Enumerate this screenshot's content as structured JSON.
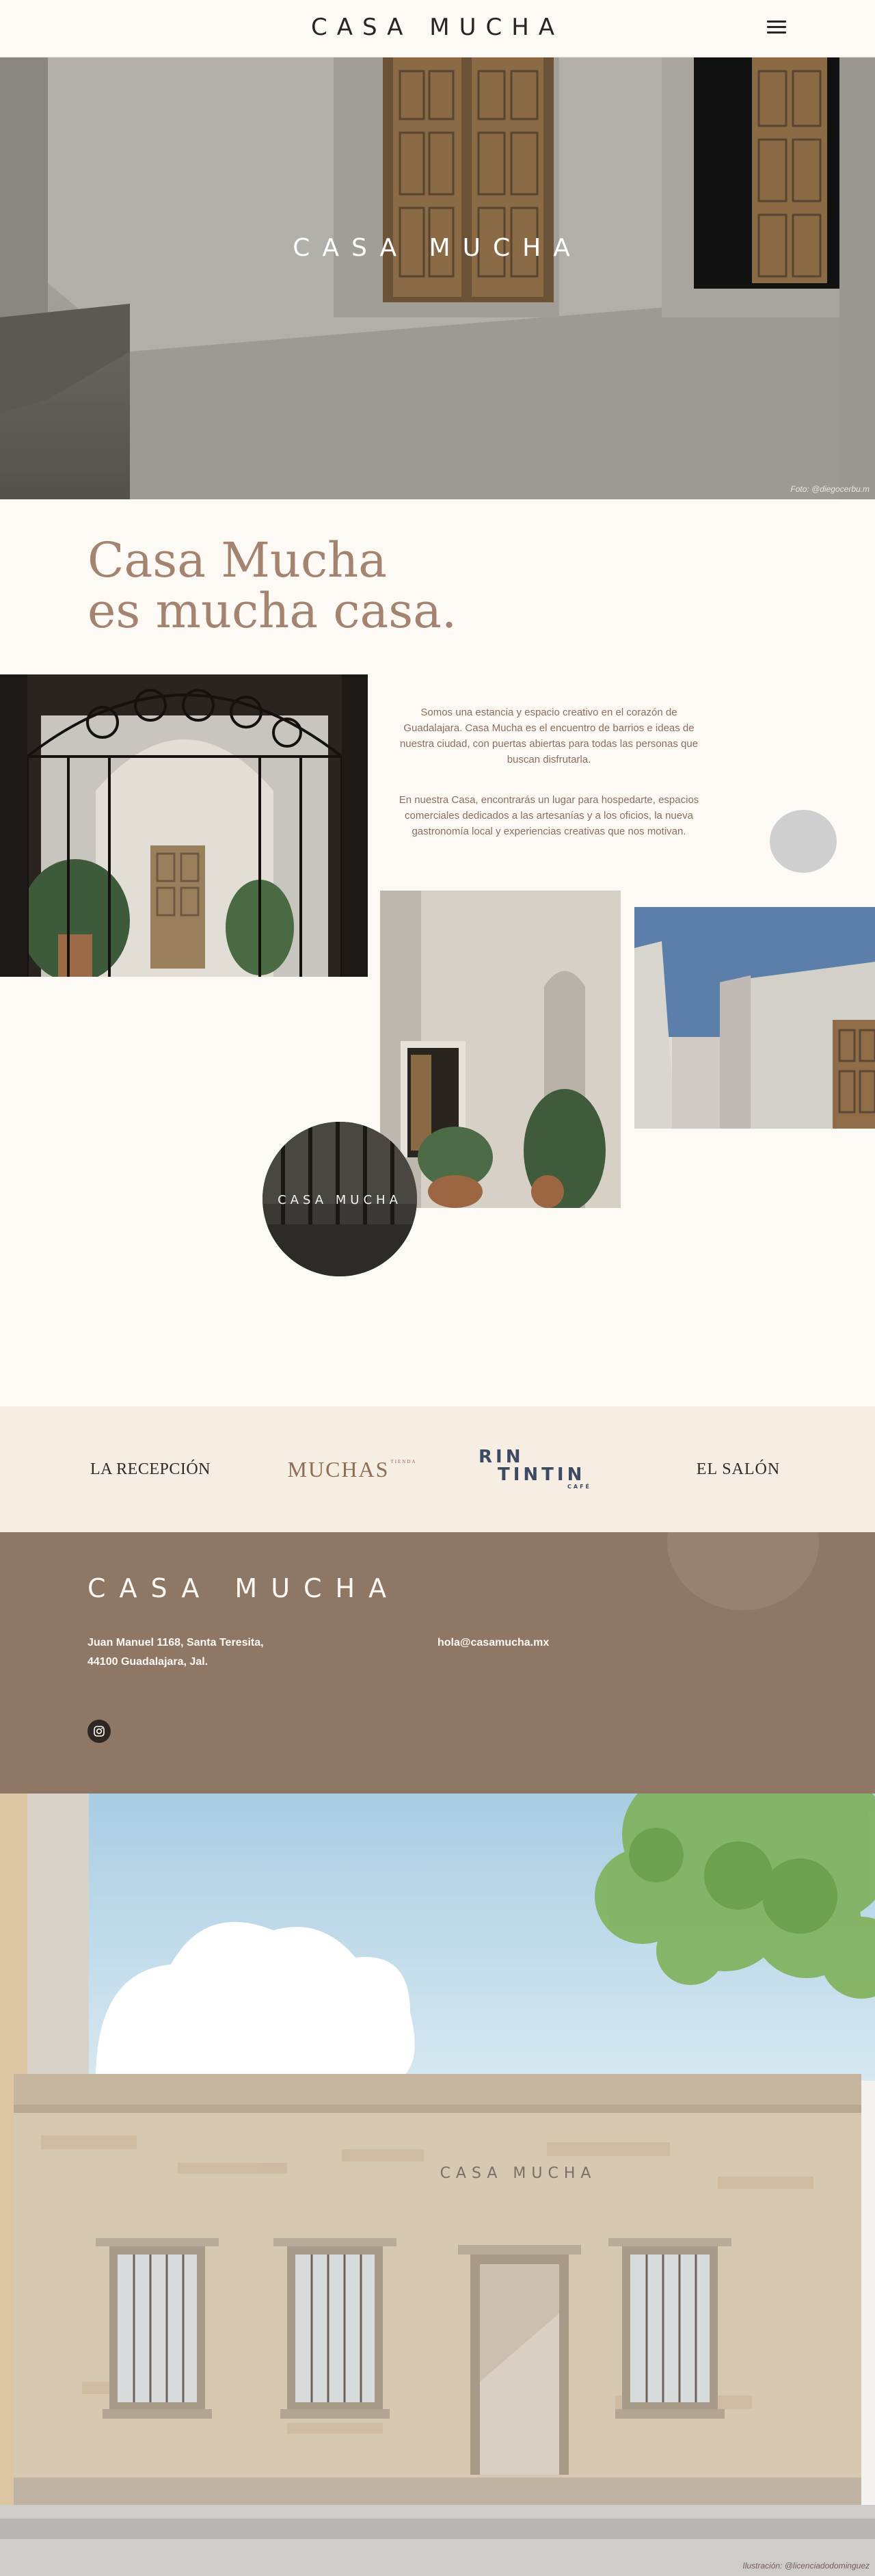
{
  "header": {
    "logo": "CASA MUCHA",
    "menu_icon": "hamburger-menu-icon"
  },
  "hero": {
    "title": "CASA MUCHA",
    "photo_credit": "Foto: @diegocerbu.m"
  },
  "intro": {
    "heading_line1": "Casa Mucha",
    "heading_line2": "es mucha casa.",
    "paragraph1": "Somos una estancia y espacio creativo en el corazón de Guadalajara. Casa Mucha es el encuentro de barrios e ideas de nuestra ciudad, con puertas abiertas para todas las personas que buscan disfrutarla.",
    "paragraph2": "En nuestra Casa, encontrarás un lugar para hospedarte, espacios comerciales dedicados a las artesanías y a los oficios, la nueva gastronomía local y experiencias creativas que nos motivan."
  },
  "brands": {
    "recepcion": "LA RECEPCIÓN",
    "muchas": "MUCHAS",
    "muchas_small": "TIENDA",
    "rintintin_line1": "RIN",
    "rintintin_line2": "TINTIN",
    "rintintin_cafe": "CAFÉ",
    "salon": "EL SALÓN"
  },
  "footer": {
    "logo": "CASA MUCHA",
    "address_line1": "Juan Manuel 1168, Santa Teresita,",
    "address_line2": "44100 Guadalajara, Jal.",
    "email": "hola@casamucha.mx",
    "social_icon": "instagram-icon"
  },
  "illustration": {
    "facade_sign": "CASA MUCHA",
    "credit": "Ilustración: @licenciadodominguez"
  },
  "colors": {
    "background": "#fdfaf6",
    "accent": "#a48470",
    "footer": "#8e7765",
    "brands_band": "#f6ede3"
  }
}
